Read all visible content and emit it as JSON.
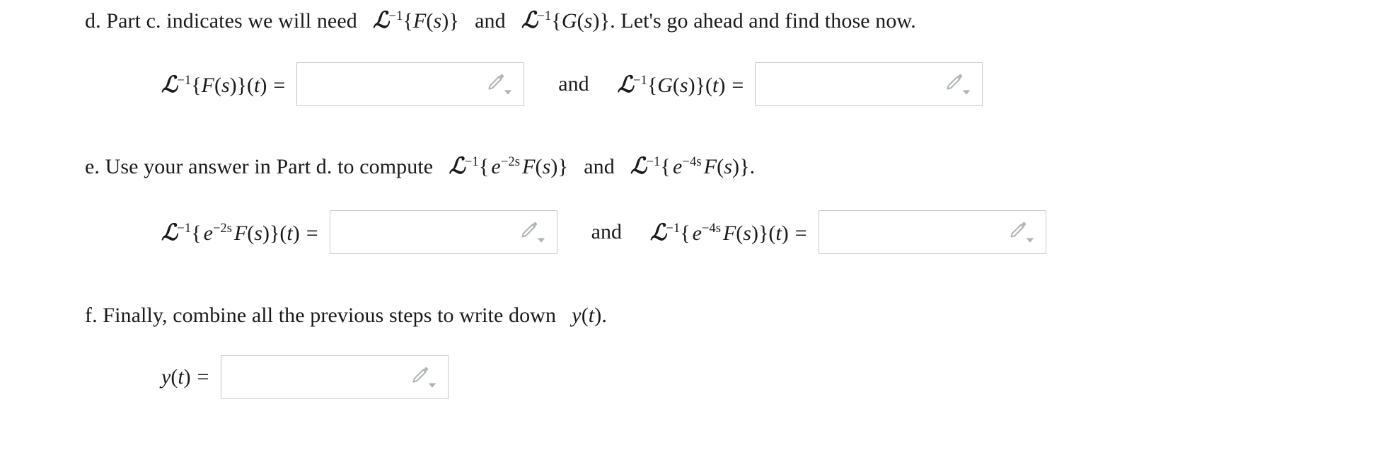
{
  "document": {
    "background_color": "#ffffff",
    "text_color": "#1a1a1a",
    "box_border_color": "#c9c9c9",
    "icon_color": "#b0b4b8"
  },
  "parts": [
    {
      "marker": "d.",
      "prompt_plain": "d. Part c. indicates we will need L^-1{F(s)} and L^-1{G(s)}. Let's go ahead and find those now.",
      "text_before": "d. Part c. indicates we will need",
      "text_middle": "and",
      "text_after": ". Let's go ahead and find those now."
    },
    {
      "marker": "e.",
      "prompt_plain": "e. Use your answer in Part d. to compute L^-1{e^-2s F(s)} and L^-1{e^-4s F(s)}.",
      "text_before": "e. Use your answer in Part d. to compute",
      "text_middle": "and",
      "text_after": "."
    },
    {
      "marker": "f.",
      "prompt_plain": "f. Finally, combine all the previous steps to write down y(t).",
      "text_before": "f. Finally, combine all the previous steps to write down",
      "text_after": "."
    }
  ],
  "answer_rows": [
    {
      "id": "row-d",
      "conjunction": "and",
      "fields": [
        {
          "id": "inv-laplace-F",
          "label_plain": "L^-1{F(s)}(t) =",
          "value": "",
          "placeholder": "",
          "tooltip": "Math entry"
        },
        {
          "id": "inv-laplace-G",
          "label_plain": "L^-1{G(s)}(t) =",
          "value": "",
          "placeholder": "",
          "tooltip": "Math entry"
        }
      ]
    },
    {
      "id": "row-e",
      "conjunction": "and",
      "fields": [
        {
          "id": "inv-laplace-e2s-F",
          "label_plain": "L^-1{e^-2s F(s)}(t) =",
          "value": "",
          "placeholder": "",
          "tooltip": "Math entry"
        },
        {
          "id": "inv-laplace-e4s-F",
          "label_plain": "L^-1{e^-4s F(s)}(t) =",
          "value": "",
          "placeholder": "",
          "tooltip": "Math entry"
        }
      ]
    },
    {
      "id": "row-f",
      "conjunction": "",
      "fields": [
        {
          "id": "solution-y",
          "label_plain": "y(t) =",
          "value": "",
          "placeholder": "",
          "tooltip": "Math entry"
        }
      ]
    }
  ],
  "symbols": {
    "laplace": "ℒ",
    "inverse_exponent": "−1",
    "minus": "−",
    "equals": "=",
    "open_brace": "{",
    "close_brace": "}",
    "open_paren": "(",
    "close_paren": ")",
    "var_F": "F",
    "var_G": "G",
    "var_s": "s",
    "var_t": "t",
    "var_y": "y",
    "var_e": "e",
    "exp_2s": "−2s",
    "exp_4s": "−4s"
  },
  "icons": {
    "pencil": "pencil-icon",
    "caret": "chevron-down-icon"
  }
}
